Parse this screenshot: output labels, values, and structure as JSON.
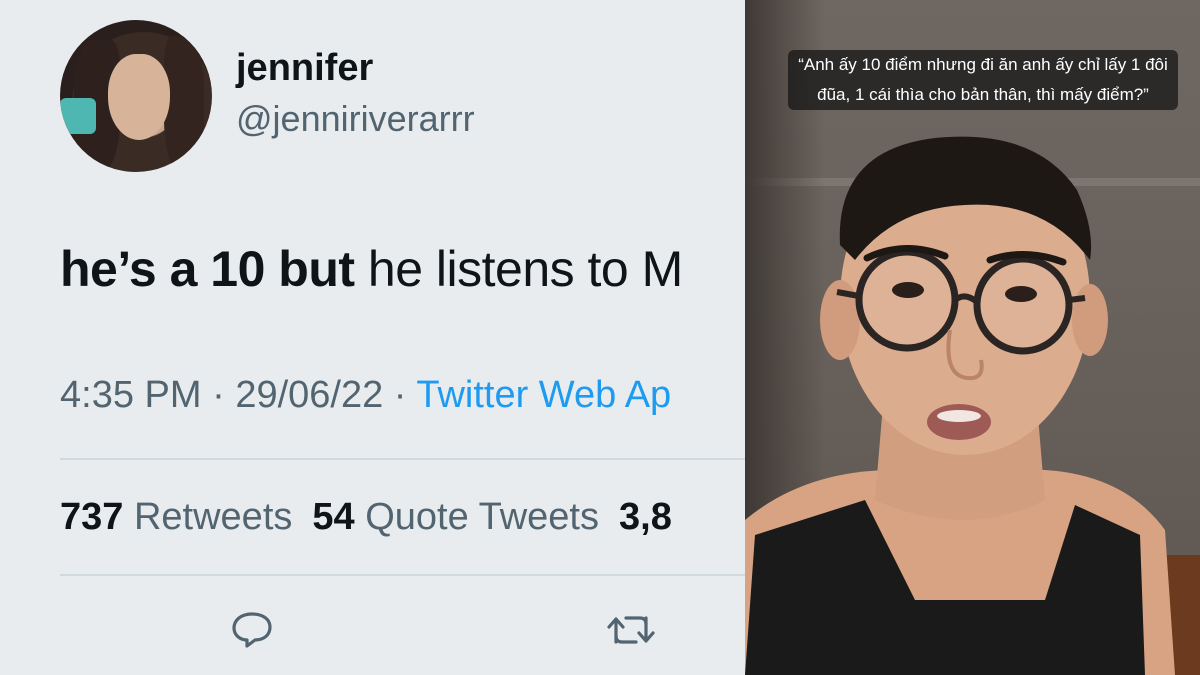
{
  "tweet": {
    "display_name": "jennifer",
    "handle": "@jenniriverarrr",
    "text_bold": "he’s a 10 but",
    "text_rest": " he listens to M",
    "time": "4:35 PM",
    "separator": " · ",
    "date": "29/06/22",
    "source": "Twitter Web Ap",
    "stats": {
      "retweets_count": "737",
      "retweets_label": "Retweets",
      "quotes_count": "54",
      "quotes_label": "Quote Tweets",
      "likes_count_partial": "3,8"
    },
    "actions": {
      "reply_icon": "reply-icon",
      "retweet_icon": "retweet-icon"
    }
  },
  "video": {
    "caption": "“Anh ấy 10 điểm nhưng đi ăn anh ấy chỉ lấy 1 đôi đũa, 1 cái thìa cho bản thân, thì mấy điểm?”"
  },
  "colors": {
    "tweet_bg": "#e9ecef",
    "text_primary": "#0f1419",
    "text_secondary": "#536471",
    "link_blue": "#1d9bf0"
  }
}
